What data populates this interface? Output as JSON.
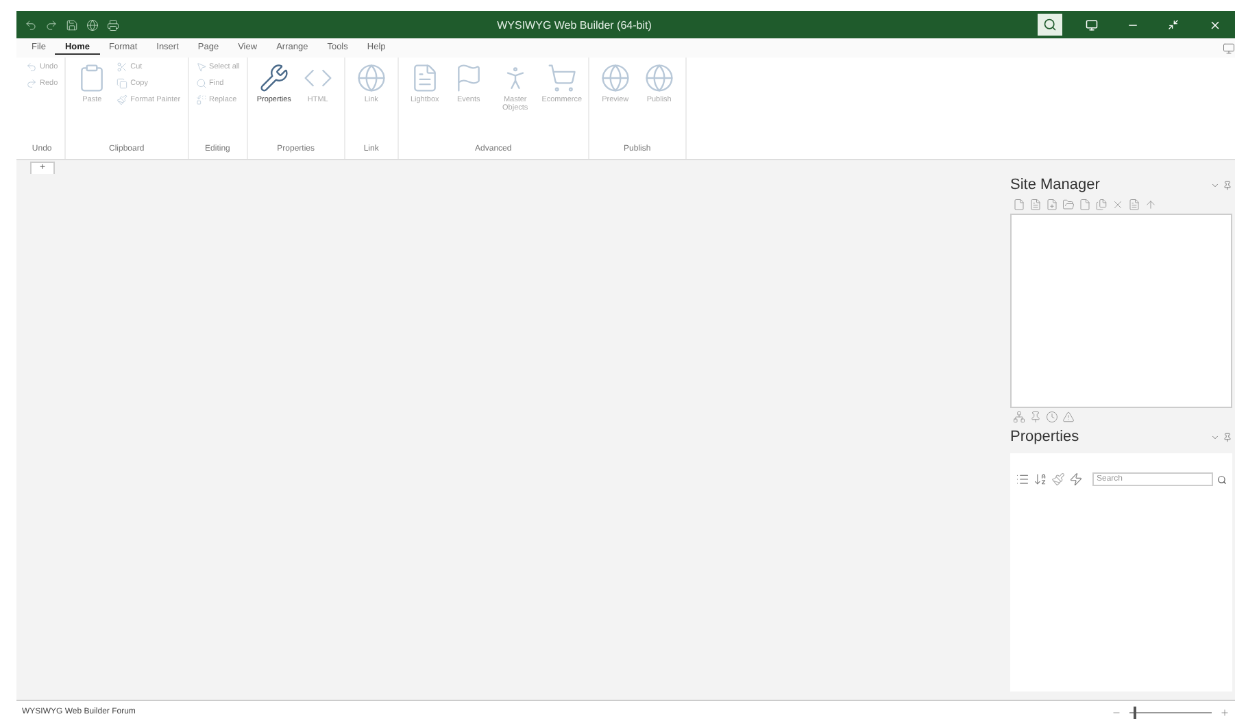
{
  "window": {
    "title": "WYSIWYG Web Builder (64-bit)"
  },
  "menu_tabs": [
    {
      "label": "File",
      "selected": false
    },
    {
      "label": "Home",
      "selected": true
    },
    {
      "label": "Format",
      "selected": false
    },
    {
      "label": "Insert",
      "selected": false
    },
    {
      "label": "Page",
      "selected": false
    },
    {
      "label": "View",
      "selected": false
    },
    {
      "label": "Arrange",
      "selected": false
    },
    {
      "label": "Tools",
      "selected": false
    },
    {
      "label": "Help",
      "selected": false
    }
  ],
  "ribbon_groups": [
    {
      "label": "Undo",
      "items": [
        {
          "kind": "small",
          "label": "Undo",
          "disabled": true
        },
        {
          "kind": "small",
          "label": "Redo",
          "disabled": true
        }
      ]
    },
    {
      "label": "Clipboard",
      "items": [
        {
          "kind": "large",
          "label": "Paste",
          "disabled": true
        },
        {
          "kind": "small",
          "label": "Cut",
          "disabled": true
        },
        {
          "kind": "small",
          "label": "Copy",
          "disabled": true
        },
        {
          "kind": "small",
          "label": "Format Painter",
          "disabled": true
        }
      ]
    },
    {
      "label": "Editing",
      "items": [
        {
          "kind": "small",
          "label": "Select all",
          "disabled": true
        },
        {
          "kind": "small",
          "label": "Find",
          "disabled": true
        },
        {
          "kind": "small",
          "label": "Replace",
          "disabled": true
        }
      ]
    },
    {
      "label": "Properties",
      "items": [
        {
          "kind": "large",
          "label": "Properties",
          "disabled": false
        },
        {
          "kind": "large",
          "label": "HTML",
          "disabled": true
        }
      ]
    },
    {
      "label": "Link",
      "items": [
        {
          "kind": "large",
          "label": "Link",
          "disabled": true
        }
      ]
    },
    {
      "label": "Advanced",
      "items": [
        {
          "kind": "large",
          "label": "Lightbox",
          "disabled": true
        },
        {
          "kind": "large",
          "label": "Events",
          "disabled": true
        },
        {
          "kind": "large",
          "label": "Master Objects",
          "disabled": true
        },
        {
          "kind": "large",
          "label": "Ecommerce",
          "disabled": true
        }
      ]
    },
    {
      "label": "Publish",
      "items": [
        {
          "kind": "large",
          "label": "Preview",
          "disabled": true
        },
        {
          "kind": "large",
          "label": "Publish",
          "disabled": true
        }
      ]
    }
  ],
  "doc_tabs": [
    {
      "label": "+"
    }
  ],
  "site_manager": {
    "title": "Site Manager"
  },
  "properties": {
    "title": "Properties",
    "search": {
      "placeholder": "Search"
    }
  },
  "status_bar": {
    "text": "WYSIWYG Web Builder Forum",
    "zoom": {
      "level": 0.05
    }
  }
}
